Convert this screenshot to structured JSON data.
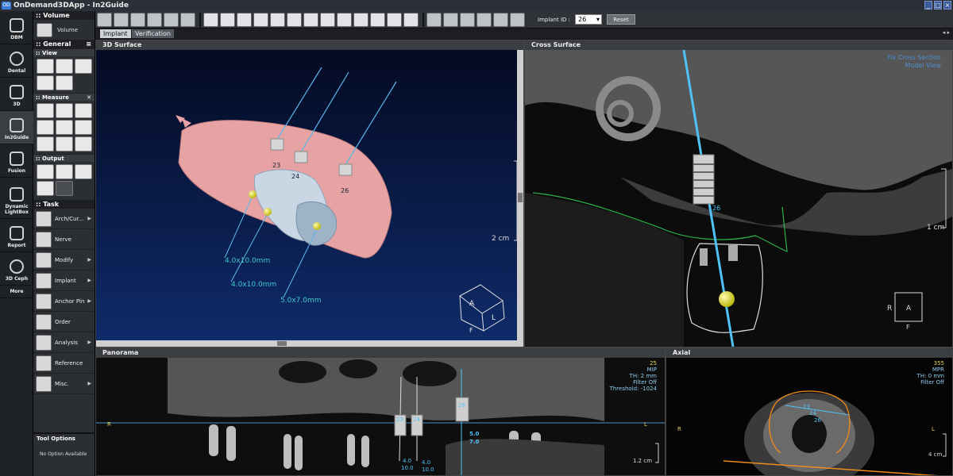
{
  "app": {
    "title": "OnDemand3DApp - In2Guide",
    "logo": "OD"
  },
  "rail": [
    {
      "label": "DBM",
      "icon": "database-icon"
    },
    {
      "label": "Dental",
      "icon": "tooth-icon"
    },
    {
      "label": "3D",
      "icon": "skull-3d-icon"
    },
    {
      "label": "In2Guide",
      "icon": "implant-guide-icon"
    },
    {
      "label": "Fusion",
      "icon": "fusion-icon"
    },
    {
      "label": "Dynamic LightBox",
      "icon": "lightbox-icon"
    },
    {
      "label": "Report",
      "icon": "report-icon"
    },
    {
      "label": "3D Ceph",
      "icon": "ceph-icon"
    },
    {
      "label": "More",
      "icon": ""
    }
  ],
  "panel": {
    "volume_head": "Volume",
    "volume_btn": "Volume",
    "general_head": "General",
    "view_head": "View",
    "measure_head": "Measure",
    "output_head": "Output",
    "task_head": "Task",
    "tasks": [
      {
        "label": "Arch/Cur...",
        "arrow": "▶"
      },
      {
        "label": "Nerve",
        "arrow": ""
      },
      {
        "label": "Modify",
        "arrow": "▶"
      },
      {
        "label": "Implant",
        "arrow": "▶"
      },
      {
        "label": "Anchor Pin",
        "arrow": "▶"
      },
      {
        "label": "Order",
        "arrow": ""
      },
      {
        "label": "Analysis",
        "arrow": "▶"
      },
      {
        "label": "Reference",
        "arrow": ""
      },
      {
        "label": "Misc.",
        "arrow": "▶"
      }
    ],
    "tool_options_head": "Tool Options",
    "tool_options_body": "No Option Available"
  },
  "toolbar": {
    "implant_id_label": "Implant ID :",
    "implant_id_value": "26",
    "reset_label": "Reset"
  },
  "tabs": {
    "implant": "Implant",
    "verification": "Verification",
    "nav": "◂ ▸"
  },
  "views": {
    "surface": {
      "title": "3D Surface",
      "scale": "2 cm",
      "implant_ids": [
        "23",
        "24",
        "26"
      ],
      "implant_labels": [
        "4.0x10.0mm",
        "4.0x10.0mm",
        "5.0x7.0mm"
      ],
      "cube": [
        "A",
        "L",
        "F"
      ]
    },
    "cross": {
      "title": "Cross Surface",
      "overlay": [
        "Fix Cross Section",
        "Model View"
      ],
      "scale": "1 cm",
      "implant_id": "26",
      "cube": [
        "R",
        "A",
        "F"
      ]
    },
    "panorama": {
      "title": "Panorama",
      "overlay": [
        "25",
        "MIP",
        "TH: 2 mm",
        "Filter Off",
        "Threshold: -1024"
      ],
      "left_dir": "R",
      "right_dir": "L",
      "scale": "1.2 cm",
      "implant_ids": [
        "23",
        "24",
        "26"
      ],
      "sizes": [
        [
          "4.0",
          "10.0"
        ],
        [
          "4.0",
          "10.0"
        ],
        [
          "5.0",
          "7.0"
        ]
      ]
    },
    "axial": {
      "title": "Axial",
      "overlay": [
        "355",
        "MPR",
        "TH: 0 mm",
        "Filter Off"
      ],
      "left_dir": "R",
      "right_dir": "L",
      "scale": "4 cm",
      "implant_ids": [
        "23",
        "24",
        "26"
      ]
    }
  },
  "colors": {
    "accent_cyan": "#4fc3f7",
    "gum_pink": "#e7a3a3",
    "sphere_yellow": "#e6e21a",
    "nerve_green": "#2bb24c",
    "arch_orange": "#f08c1a"
  }
}
